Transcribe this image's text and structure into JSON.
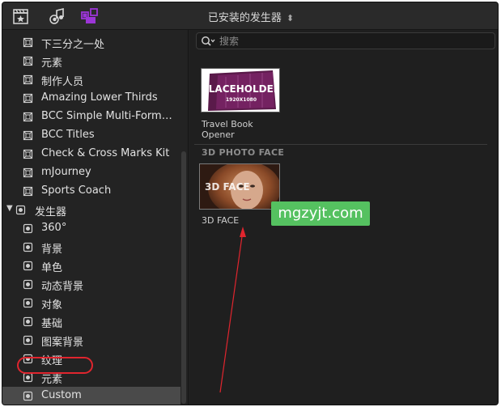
{
  "toolbar": {
    "title": "已安装的发生器",
    "icons": [
      "film-clapper-star-icon",
      "music-note-icon",
      "generators-icon"
    ]
  },
  "sidebar": {
    "items": [
      {
        "label": "下三分之一处",
        "type": "child"
      },
      {
        "label": "元素",
        "type": "child"
      },
      {
        "label": "制作人员",
        "type": "child"
      },
      {
        "label": "Amazing Lower Thirds",
        "type": "child"
      },
      {
        "label": "BCC Simple Multi-Format Titles",
        "type": "child"
      },
      {
        "label": "BCC Titles",
        "type": "child"
      },
      {
        "label": "Check & Cross Marks Kit",
        "type": "child"
      },
      {
        "label": "mJourney",
        "type": "child"
      },
      {
        "label": "Sports Coach",
        "type": "child"
      },
      {
        "label": "发生器",
        "type": "group"
      },
      {
        "label": "360°",
        "type": "child"
      },
      {
        "label": "背景",
        "type": "child"
      },
      {
        "label": "单色",
        "type": "child"
      },
      {
        "label": "动态背景",
        "type": "child"
      },
      {
        "label": "对象",
        "type": "child"
      },
      {
        "label": "基础",
        "type": "child"
      },
      {
        "label": "图案背景",
        "type": "child"
      },
      {
        "label": "纹理",
        "type": "child"
      },
      {
        "label": "元素",
        "type": "child"
      },
      {
        "label": "Custom",
        "type": "child",
        "selected": true
      }
    ]
  },
  "search": {
    "placeholder": "搜索",
    "value": ""
  },
  "browser": {
    "item1": {
      "thumb_text_top": "PLACEHOLDER",
      "thumb_text_size": "1920X1080",
      "label_line1": "Travel Book",
      "label_line2": "Opener"
    },
    "section_header": "3D PHOTO FACE",
    "item2": {
      "thumb_text": "3D FACE",
      "label": "3D FACE"
    }
  },
  "watermark": "mgzyjt.com",
  "colors": {
    "highlight_oval": "#e0252e",
    "arrow": "#e0252e",
    "watermark_bg": "#55c160",
    "accent_purple": "#9b35d6"
  }
}
